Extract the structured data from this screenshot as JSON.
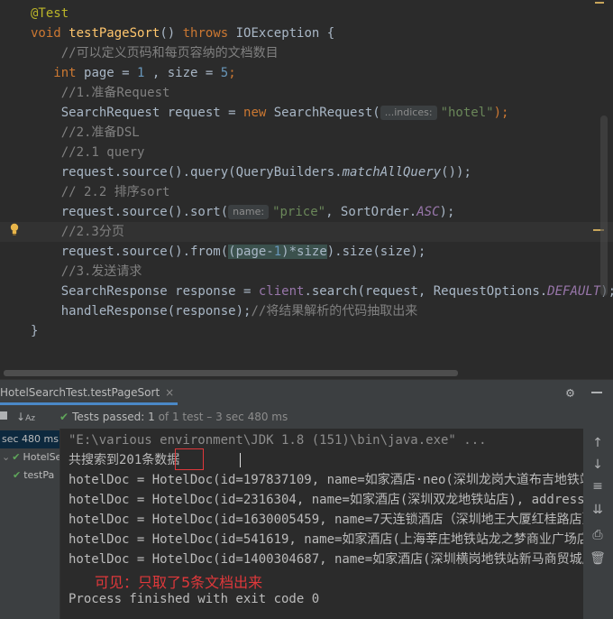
{
  "editor": {
    "lines": [
      {
        "segments": [
          {
            "t": "@Test",
            "c": "ann"
          }
        ]
      },
      {
        "segments": [
          {
            "t": "void ",
            "c": "kw"
          },
          {
            "t": "testPageSort",
            "c": "fn"
          },
          {
            "t": "() "
          },
          {
            "t": "throws ",
            "c": "kw"
          },
          {
            "t": "IOException {"
          }
        ]
      },
      {
        "segments": [
          {
            "t": "    //可以定义页码和每页容纳的文档数目",
            "c": "cmt"
          }
        ]
      },
      {
        "segments": [
          {
            "t": "   "
          },
          {
            "t": "int ",
            "c": "kw"
          },
          {
            "t": "page = "
          },
          {
            "t": "1",
            "c": "num"
          },
          {
            "t": " , size = "
          },
          {
            "t": "5",
            "c": "num"
          },
          {
            "t": ";",
            "c": "kw"
          }
        ]
      },
      {
        "segments": [
          {
            "t": "    //1.准备Request",
            "c": "cmt"
          }
        ]
      },
      {
        "segments": [
          {
            "t": "    SearchRequest request = "
          },
          {
            "t": "new ",
            "c": "kw"
          },
          {
            "t": "SearchRequest("
          },
          {
            "hint": "...indices:"
          },
          {
            "t": "\"hotel\"",
            "c": "str"
          },
          {
            "t": ");",
            "c": "kw"
          }
        ]
      },
      {
        "segments": [
          {
            "t": "    //2.准备DSL",
            "c": "cmt"
          }
        ]
      },
      {
        "segments": [
          {
            "t": "    //2.1 query",
            "c": "cmt"
          }
        ]
      },
      {
        "segments": [
          {
            "t": "    request.source().query(QueryBuilders."
          },
          {
            "t": "matchAllQuery",
            "c": "ital-fn"
          },
          {
            "t": "());"
          }
        ]
      },
      {
        "segments": [
          {
            "t": "    // 2.2 排序sort",
            "c": "cmt"
          }
        ]
      },
      {
        "segments": [
          {
            "t": "    request.source().sort("
          },
          {
            "hint": "name:"
          },
          {
            "t": "\"price\"",
            "c": "str"
          },
          {
            "t": ", SortOrder."
          },
          {
            "t": "ASC",
            "c": "ital-fld"
          },
          {
            "t": ");"
          }
        ]
      },
      {
        "segments": [
          {
            "t": "    //2.3分页",
            "c": "cmt"
          }
        ]
      },
      {
        "segments": [
          {
            "t": "    request.source().from("
          },
          {
            "t": "(page-",
            "c": "paren-hl"
          },
          {
            "t": "1",
            "c": "num paren-hl"
          },
          {
            "t": ")*size",
            "c": "paren-hl"
          },
          {
            "t": ").size(size);"
          }
        ]
      },
      {
        "segments": [
          {
            "t": "    //3.发送请求",
            "c": "cmt"
          }
        ]
      },
      {
        "segments": [
          {
            "t": "    SearchResponse response = "
          },
          {
            "t": "client",
            "c": "fld"
          },
          {
            "t": ".search(request, RequestOptions."
          },
          {
            "t": "DEFAULT",
            "c": "ital-fld"
          },
          {
            "t": ");"
          }
        ]
      },
      {
        "segments": [
          {
            "t": "    handleResponse(response);"
          },
          {
            "t": "//将结果解析的代码抽取出来",
            "c": "cmt"
          }
        ]
      },
      {
        "segments": [
          {
            "t": "}"
          }
        ]
      }
    ]
  },
  "run_panel": {
    "tab_label": "HotelSearchTest.testPageSort",
    "tab_close": "×",
    "status": {
      "label": "Tests passed:",
      "count": "1",
      "detail": "of 1 test – 3 sec 480 ms"
    },
    "toolbar_icons": [
      "stop-icon",
      "sort-alpha-icon",
      "check-icon"
    ],
    "tree": [
      {
        "label": "sec 480 ms"
      },
      {
        "label": "HotelSea"
      },
      {
        "label": "testPa"
      }
    ],
    "console": {
      "lines": [
        {
          "text": "\"E:\\various environment\\JDK 1.8 (151)\\bin\\java.exe\" ...",
          "gray": true
        },
        {
          "text": "共搜索到201条数据"
        },
        {
          "text": "hotelDoc = HotelDoc(id=197837109, name=如家酒店·neo(深圳龙岗大道布吉地铁站店)"
        },
        {
          "text": "hotelDoc = HotelDoc(id=2316304, name=如家酒店(深圳双龙地铁站店), address=龙岗"
        },
        {
          "text": "hotelDoc = HotelDoc(id=1630005459, name=7天连锁酒店（深圳地王大厦红桂路店）"
        },
        {
          "text": "hotelDoc = HotelDoc(id=541619, name=如家酒店(上海莘庄地铁站龙之梦商业广场店)"
        },
        {
          "text": "hotelDoc = HotelDoc(id=1400304687, name=如家酒店(深圳横岗地铁站新马商贸城店)"
        },
        {
          "text": ""
        },
        {
          "text": "Process finished with exit code 0"
        }
      ],
      "annotation": "可见：只取了5条文档出来"
    },
    "right_icons": [
      "arrow-up-icon",
      "arrow-down-icon",
      "wrap-icon",
      "scroll-end-icon",
      "print-icon",
      "trash-icon"
    ]
  }
}
